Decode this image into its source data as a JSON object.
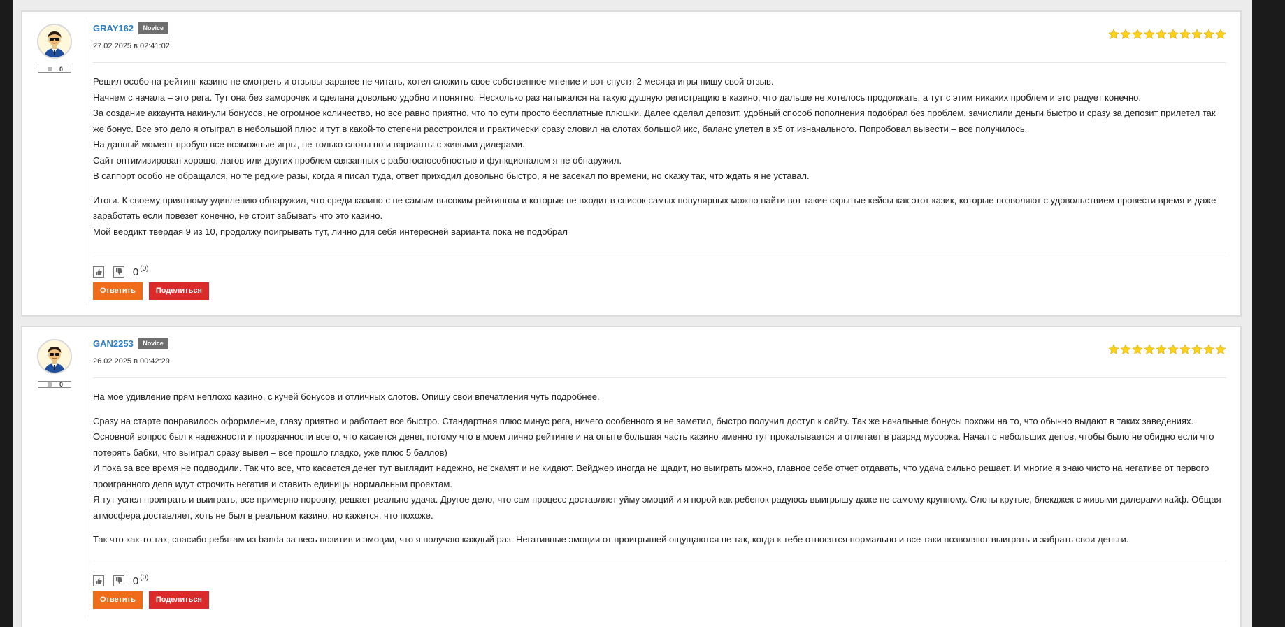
{
  "colors": {
    "username": "#2f7fc1",
    "reply_button": "#ef6c1a",
    "share_button": "#db2a2a",
    "star": "#ffd21a",
    "rank_badge": "#6f6f6f"
  },
  "reviews": [
    {
      "username": "GRAY162",
      "rank": "Novice",
      "date": "27.02.2025 в 02:41:02",
      "reputation": "0",
      "rating": 10,
      "rating_max": 10,
      "paragraphs": [
        [
          "Решил особо на рейтинг казино не смотреть и отзывы заранее не читать, хотел сложить свое собственное мнение и вот спустя 2 месяца игры пишу свой отзыв.",
          "Начнем с начала – это рега. Тут она без заморочек и сделана довольно удобно и понятно. Несколько раз натыкался на такую душную регистрацию в казино, что дальше не хотелось продолжать, а тут с этим никаких проблем и это радует конечно.",
          "За создание аккаунта накинули бонусов, не огромное количество, но все равно приятно, что по сути просто бесплатные плюшки. Далее сделал депозит, удобный способ пополнения подобрал без проблем, зачислили деньги быстро и сразу за депозит прилетел так же бонус. Все это дело я отыграл в небольшой плюс и тут в какой-то степени расстроился и практически сразу словил на слотах большой икс, баланс улетел в х5 от изначального. Попробовал вывести – все получилось.",
          "На данный момент пробую все возможные игры, не только слоты но и варианты с живыми дилерами.",
          "Сайт оптимизирован хорошо, лагов или других проблем связанных с работоспособностью и функционалом я не обнаружил.",
          "В саппорт особо не обращался, но те редкие разы, когда я писал туда, ответ приходил довольно быстро, я не засекал по времени, но скажу так, что ждать я не уставал."
        ],
        [
          "Итоги. К своему приятному удивлению обнаружил, что среди казино с не самым высоким рейтингом и которые не входит в список самых популярных можно найти вот такие скрытые кейсы как этот казик, которые позволяют с удовольствием провести время и даже заработать если повезет конечно, не стоит забывать что это казино.",
          "Мой вердикт твердая 9 из 10, продолжу поигрывать тут, лично для себя интересней варианта пока не подобрал"
        ]
      ],
      "score": "0",
      "votes": "(0)",
      "reply_label": "Ответить",
      "share_label": "Поделиться"
    },
    {
      "username": "GAN2253",
      "rank": "Novice",
      "date": "26.02.2025 в 00:42:29",
      "reputation": "0",
      "rating": 10,
      "rating_max": 10,
      "paragraphs": [
        [
          "На мое удивление прям неплохо казино, с кучей бонусов и отличных слотов. Опишу свои впечатления чуть подробнее."
        ],
        [
          "Сразу на старте понравилось оформление, глазу приятно и работает все быстро. Стандартная плюс минус рега, ничего особенного я не заметил, быстро получил доступ к сайту. Так же начальные бонусы похожи на то, что обычно выдают в таких заведениях. Основной вопрос был к надежности и прозрачности всего, что касается денег, потому что в моем лично рейтинге и на опыте большая часть казино именно тут прокалывается и отлетает в разряд мусорка. Начал с небольших депов, чтобы было не обидно если что потерять бабки, что выиграл сразу вывел – все прошло гладко, уже плюс 5 баллов)",
          "И пока за все время не подводили. Так что все, что касается денег тут выглядит надежно, не скамят и не кидают. Вейджер иногда не щадит, но выиграть можно, главное себе отчет отдавать, что удача сильно решает. И многие я знаю чисто на негативе от первого проигранного депа идут строчить негатив и ставить единицы нормальным проектам.",
          "Я тут успел проиграть и выиграть, все примерно поровну, решает реально удача. Другое дело, что сам процесс доставляет уйму эмоций и я порой как ребенок радуюсь выигрышу даже не самому крупному. Слоты крутые, блекджек с живыми дилерами кайф. Общая атмосфера доставляет, хоть не был в реальном казино, но кажется, что похоже."
        ],
        [
          "Так что как-то так, спасибо ребятам из banda за весь позитив и эмоции, что я получаю каждый раз. Негативные эмоции от проигрышей ощущаются не так, когда к тебе относятся нормально и все таки позволяют выиграть и забрать свои деньги."
        ]
      ],
      "score": "0",
      "votes": "(0)",
      "reply_label": "Ответить",
      "share_label": "Поделиться"
    }
  ]
}
